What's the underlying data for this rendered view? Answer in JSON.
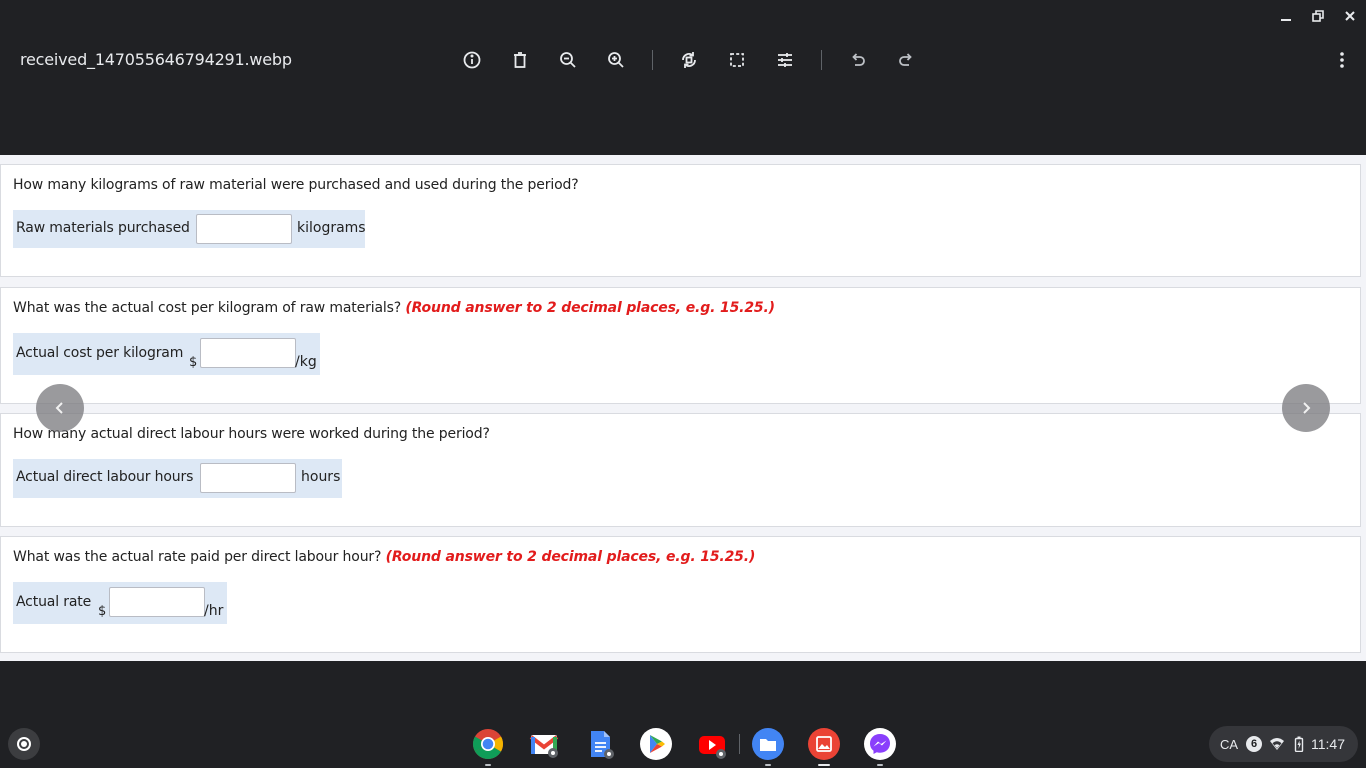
{
  "window": {
    "filename": "received_147055646794291.webp",
    "controls": [
      "minimize-icon",
      "restore-icon",
      "close-icon"
    ]
  },
  "toolbar": {
    "icons": [
      "info-icon",
      "delete-icon",
      "zoom-out-icon",
      "zoom-in-icon",
      "rotate-icon",
      "crop-icon",
      "adjust-icon",
      "undo-icon",
      "redo-icon",
      "more-icon"
    ]
  },
  "questions": [
    {
      "prompt": "How many kilograms of raw material were purchased and used during the period?",
      "note": "",
      "label": "Raw materials purchased",
      "prefix": "",
      "value": "",
      "unit": "kilograms"
    },
    {
      "prompt": "What was the actual cost per kilogram of raw materials?",
      "note": "(Round answer to 2 decimal places, e.g. 15.25.)",
      "label": "Actual cost per kilogram",
      "prefix": "$",
      "value": "",
      "unit": "/kg"
    },
    {
      "prompt": "How many actual direct labour hours were worked during the period?",
      "note": "",
      "label": "Actual direct labour hours",
      "prefix": "",
      "value": "",
      "unit": "hours"
    },
    {
      "prompt": "What was the actual rate paid per direct labour hour?",
      "note": "(Round answer to 2 decimal places, e.g. 15.25.)",
      "label": "Actual rate",
      "prefix": "$",
      "value": "",
      "unit": "/hr"
    }
  ],
  "nav": {
    "prev": "chevron-left-icon",
    "next": "chevron-right-icon"
  },
  "shelf": {
    "apps": [
      "Chrome",
      "Gmail",
      "Google Docs",
      "Google Play",
      "YouTube",
      "Files",
      "Gallery",
      "Messenger"
    ]
  },
  "tray": {
    "keyboard": "CA",
    "notification_count": "6",
    "time": "11:47"
  },
  "colors": {
    "frame": "#202124",
    "note_red": "#e21c1c",
    "answer_bg": "#dde8f5"
  }
}
